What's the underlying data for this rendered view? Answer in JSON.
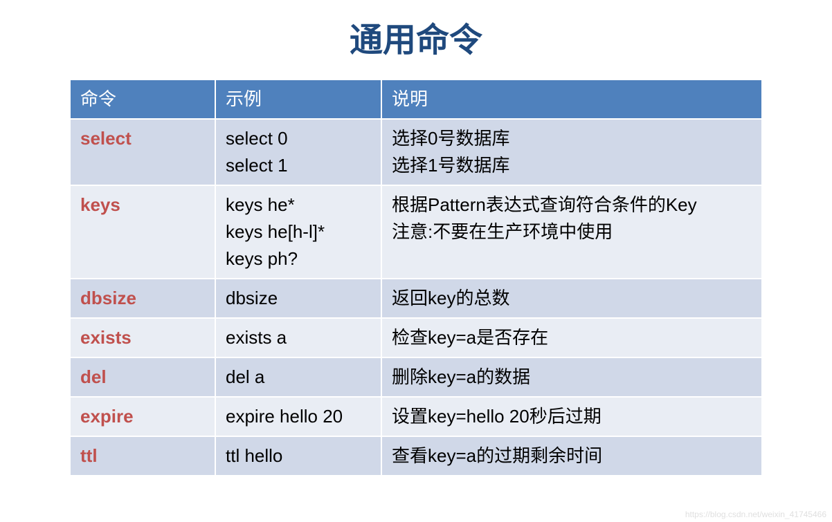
{
  "title": "通用命令",
  "headers": {
    "cmd": "命令",
    "example": "示例",
    "desc": "说明"
  },
  "rows": [
    {
      "cmd": "select",
      "example": "select 0\nselect 1",
      "desc": "选择0号数据库\n选择1号数据库"
    },
    {
      "cmd": "keys",
      "example": "keys he*\nkeys he[h-l]*\nkeys ph?",
      "desc": "根据Pattern表达式查询符合条件的Key\n注意:不要在生产环境中使用"
    },
    {
      "cmd": "dbsize",
      "example": "dbsize",
      "desc": "返回key的总数"
    },
    {
      "cmd": "exists",
      "example": "exists a",
      "desc": "检查key=a是否存在"
    },
    {
      "cmd": "del",
      "example": "del a",
      "desc": "删除key=a的数据"
    },
    {
      "cmd": "expire",
      "example": "expire hello 20",
      "desc": "设置key=hello 20秒后过期"
    },
    {
      "cmd": "ttl",
      "example": "ttl hello",
      "desc": "查看key=a的过期剩余时间"
    }
  ],
  "watermark": "https://blog.csdn.net/weixin_41745466"
}
